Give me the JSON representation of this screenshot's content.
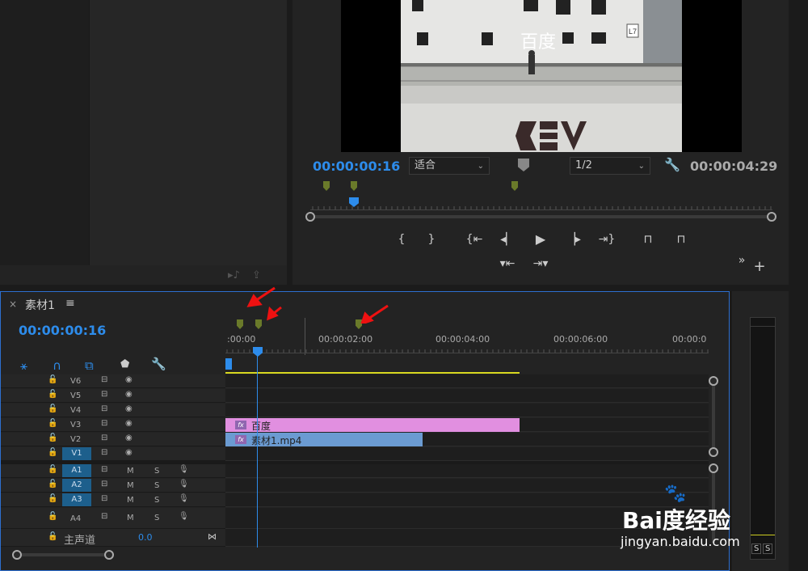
{
  "program_monitor": {
    "overlay_text": "百度",
    "sign_text": "L7",
    "current_time": "00:00:00:16",
    "zoom": "适合",
    "resolution": "1/2",
    "duration": "00:00:04:29"
  },
  "timeline": {
    "tab_close": "×",
    "sequence_name": "素材1",
    "menu_icon": "≡",
    "current_time": "00:00:00:16",
    "ruler_labels": [
      ":00:00",
      "00:00:02:00",
      "00:00:04:00",
      "00:00:06:00",
      "00:00:0"
    ],
    "video_tracks": [
      "V6",
      "V5",
      "V4",
      "V3",
      "V2",
      "V1"
    ],
    "audio_tracks": [
      "A1",
      "A2",
      "A3",
      "A4"
    ],
    "mute": "M",
    "solo": "S",
    "master_label": "主声道",
    "master_value": "0.0",
    "clips": {
      "title_clip": "百度",
      "video_clip": "素材1.mp4"
    }
  },
  "watermark": {
    "brand": "Bai度经验",
    "url": "jingyan.baidu.com"
  },
  "meter_labels": [
    "S",
    "S"
  ],
  "colors": {
    "accent_blue": "#2d8ceb",
    "title_clip": "#e18fe0",
    "video_clip": "#6b9bd2",
    "marker": "#6a7a2a",
    "arrow": "#e11111"
  }
}
